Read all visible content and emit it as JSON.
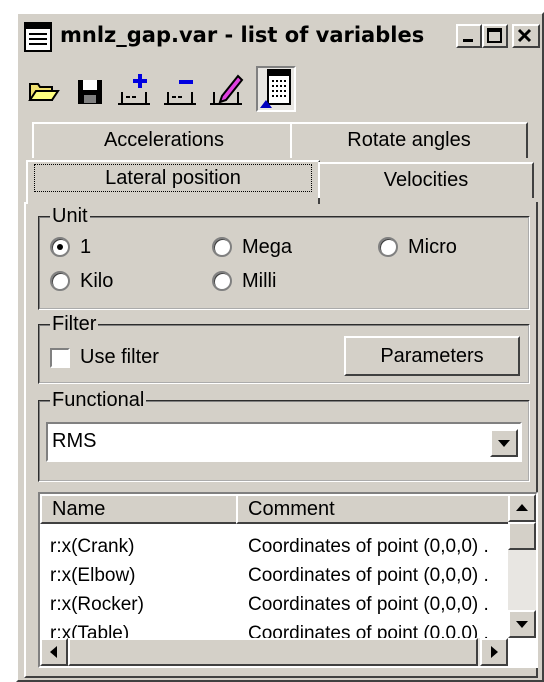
{
  "window": {
    "title": "mnlz_gap.var - list of variables"
  },
  "titlebar_buttons": [
    {
      "icon": "minimize-icon"
    },
    {
      "icon": "maximize-icon"
    },
    {
      "icon": "close-icon"
    }
  ],
  "toolbar": {
    "tools": [
      {
        "icon": "open-folder-icon"
      },
      {
        "icon": "save-disk-icon"
      },
      {
        "icon": "add-variable-icon"
      },
      {
        "icon": "remove-variable-icon"
      },
      {
        "icon": "edit-variable-icon"
      },
      {
        "icon": "calculator-icon",
        "pressed": true
      }
    ]
  },
  "tabs": {
    "row1": [
      "Accelerations",
      "Rotate angles"
    ],
    "row2": [
      "Lateral position",
      "Velocities"
    ],
    "active": "Lateral position"
  },
  "unit": {
    "label": "Unit",
    "options": [
      "1",
      "Mega",
      "Micro",
      "Kilo",
      "Milli"
    ],
    "selected": "1"
  },
  "filter": {
    "label": "Filter",
    "checkbox_label": "Use filter",
    "checked": false,
    "parameters_button": "Parameters"
  },
  "functional": {
    "label": "Functional",
    "value": "RMS"
  },
  "list": {
    "columns": [
      "Name",
      "Comment"
    ],
    "rows": [
      {
        "name": "r:x(Crank)",
        "comment": "Coordinates of point (0,0,0) ."
      },
      {
        "name": "r:x(Elbow)",
        "comment": "Coordinates of point (0,0,0) ."
      },
      {
        "name": "r:x(Rocker)",
        "comment": "Coordinates of point (0,0,0) ."
      },
      {
        "name": "r:x(Table)",
        "comment": "Coordinates of point (0,0,0) ."
      }
    ]
  }
}
